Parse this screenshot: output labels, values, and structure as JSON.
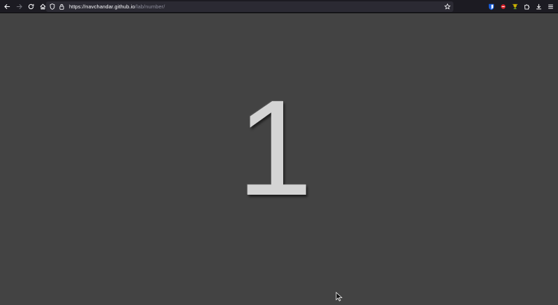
{
  "browser": {
    "url_host": "https://navchandar.github.io",
    "url_path": "/lab/number/",
    "nav": {
      "back_icon": "arrow-left-icon",
      "forward_icon": "arrow-right-icon",
      "reload_icon": "reload-icon",
      "home_icon": "home-icon"
    },
    "extensions": [
      "bitwarden-icon",
      "red-extension-icon",
      "trophy-icon",
      "puzzle-icon",
      "download-icon",
      "menu-icon"
    ]
  },
  "page": {
    "number": "1"
  },
  "colors": {
    "background": "#434343",
    "toolbar": "#1c1b22",
    "number": "#d4d4d4"
  }
}
